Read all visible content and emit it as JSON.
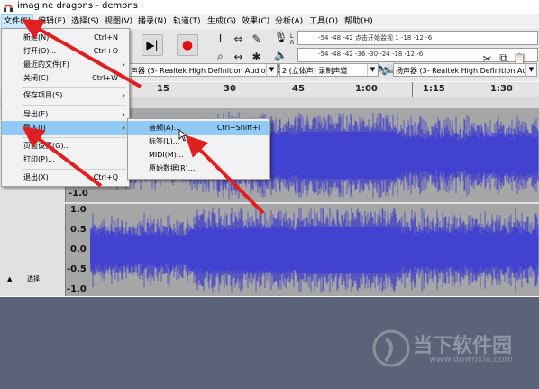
{
  "window": {
    "title": "imagine dragons - demons"
  },
  "menubar": {
    "items": [
      {
        "label": "文件(F)"
      },
      {
        "label": "编辑(E)"
      },
      {
        "label": "选择(S)"
      },
      {
        "label": "视图(V)"
      },
      {
        "label": "播录(N)"
      },
      {
        "label": "轨道(T)"
      },
      {
        "label": "生成(G)"
      },
      {
        "label": "效果(C)"
      },
      {
        "label": "分析(A)"
      },
      {
        "label": "工具(O)"
      },
      {
        "label": "帮助(H)"
      }
    ]
  },
  "toolbar": {
    "meter_ticks": "-54  -48  -42    点击开始监视  1  -18  -12  -6",
    "meter_ticks2": "-54  -48  -42  -36  -30  -24  -18  -12  -6",
    "playback_device": "声器 (3- Realtek High Definition Audio",
    "recording_channels": "2 (立体声) 录制声道",
    "output_device": "扬声器 (3- Realtek High Definition Audio"
  },
  "timeline": {
    "ticks": [
      "15",
      "30",
      "45",
      "1:00",
      "1:15",
      "1:30"
    ]
  },
  "track": {
    "amplitude_labels": [
      "-1.0",
      "1.0",
      "0.5",
      "0.0",
      "-0.5",
      "-1.0"
    ],
    "select_label": "选择"
  },
  "file_menu": {
    "items": [
      {
        "label": "新建(N)",
        "shortcut": "Ctrl+N"
      },
      {
        "label": "打开(O)...",
        "shortcut": "Ctrl+O"
      },
      {
        "label": "最近的文件(F)",
        "shortcut": "›"
      },
      {
        "label": "关闭(C)",
        "shortcut": "Ctrl+W"
      },
      {
        "label": "保存项目(S)",
        "shortcut": "›"
      },
      {
        "label": "导出(E)",
        "shortcut": "›"
      },
      {
        "label": "导入(I)",
        "shortcut": "›"
      },
      {
        "label": "页面设置(G)...",
        "shortcut": ""
      },
      {
        "label": "打印(P)...",
        "shortcut": ""
      },
      {
        "label": "退出(X)",
        "shortcut": "Ctrl+Q"
      }
    ]
  },
  "import_submenu": {
    "items": [
      {
        "label": "音频(A)...",
        "shortcut": "Ctrl+Shift+I"
      },
      {
        "label": "标签(L)...",
        "shortcut": ""
      },
      {
        "label": "MIDI(M)...",
        "shortcut": ""
      },
      {
        "label": "原始数据(R)...",
        "shortcut": ""
      }
    ]
  },
  "watermark": {
    "title": "当下软件园",
    "url": "www.downxia.com"
  },
  "colors": {
    "wave": "#3333cc",
    "wave_light": "#6666dd",
    "selection_bg": "#cce8ff",
    "arrow": "#e02020"
  }
}
